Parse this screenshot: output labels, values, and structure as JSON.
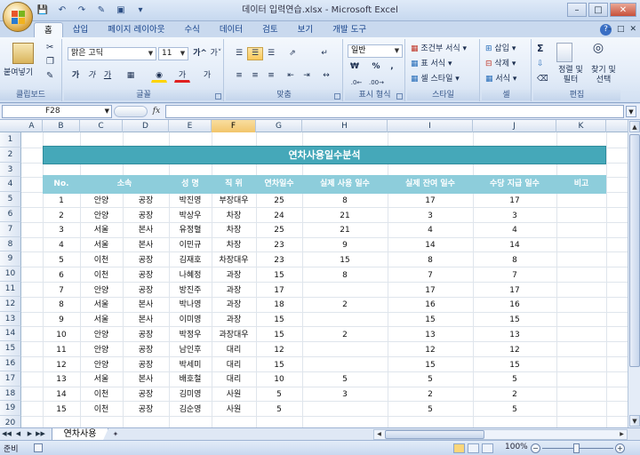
{
  "window": {
    "title": "데이터 입력연습.xlsx - Microsoft Excel",
    "controls": [
      "–",
      "□",
      "✕"
    ]
  },
  "tabs": [
    "홈",
    "삽입",
    "페이지 레이아웃",
    "수식",
    "데이터",
    "검토",
    "보기",
    "개발 도구"
  ],
  "active_tab": "홈",
  "ribbon": {
    "clipboard": {
      "label": "클립보드",
      "paste": "붙여넣기"
    },
    "font": {
      "label": "글꼴",
      "font_name": "맑은 고딕",
      "font_size": "11",
      "bold": "가",
      "italic": "가",
      "underline": "가",
      "grow": "가^",
      "shrink": "가˅"
    },
    "alignment": {
      "label": "맞춤"
    },
    "number": {
      "label": "표시 형식",
      "format": "일반",
      "currency": "₩",
      "percent": "%",
      "comma": ","
    },
    "styles": {
      "label": "스타일",
      "conditional": "조건부 서식",
      "table": "표 서식",
      "cell_style": "셀 스타일"
    },
    "cells": {
      "label": "셀",
      "insert": "삽입",
      "delete": "삭제",
      "format": "서식"
    },
    "editing": {
      "label": "편집",
      "sort_filter": "정렬 및 필터",
      "find_select": "찾기 및 선택",
      "sum": "Σ"
    }
  },
  "formula_bar": {
    "name_box": "F28",
    "fx": "fx",
    "value": ""
  },
  "columns": [
    "A",
    "B",
    "C",
    "D",
    "E",
    "F",
    "G",
    "H",
    "I",
    "J",
    "K"
  ],
  "selected_column": "F",
  "rows": [
    "1",
    "2",
    "3",
    "4",
    "5",
    "6",
    "7",
    "8",
    "9",
    "10",
    "11",
    "12",
    "13",
    "14",
    "15",
    "16",
    "17",
    "18",
    "19",
    "20"
  ],
  "sheet": {
    "title": "연차사용일수분석",
    "headers": [
      "No.",
      "소속",
      "성 명",
      "직 위",
      "연차일수",
      "실제 사용 일수",
      "실제 잔여 일수",
      "수당 지급 일수",
      "비고"
    ],
    "data": [
      [
        "1",
        "안양",
        "공장",
        "박진영",
        "부장대우",
        "25",
        "8",
        "17",
        "17",
        ""
      ],
      [
        "2",
        "안양",
        "공장",
        "박상우",
        "차장",
        "24",
        "21",
        "3",
        "3",
        ""
      ],
      [
        "3",
        "서울",
        "본사",
        "유정혈",
        "차장",
        "25",
        "21",
        "4",
        "4",
        ""
      ],
      [
        "4",
        "서울",
        "본사",
        "이민규",
        "차장",
        "23",
        "9",
        "14",
        "14",
        ""
      ],
      [
        "5",
        "이천",
        "공장",
        "김재호",
        "차장대우",
        "23",
        "15",
        "8",
        "8",
        ""
      ],
      [
        "6",
        "이천",
        "공장",
        "나혜정",
        "과장",
        "15",
        "8",
        "7",
        "7",
        ""
      ],
      [
        "7",
        "안양",
        "공장",
        "방진주",
        "과장",
        "17",
        "",
        "17",
        "17",
        ""
      ],
      [
        "8",
        "서울",
        "본사",
        "박나영",
        "과장",
        "18",
        "2",
        "16",
        "16",
        ""
      ],
      [
        "9",
        "서울",
        "본사",
        "이미영",
        "과장",
        "15",
        "",
        "15",
        "15",
        ""
      ],
      [
        "10",
        "안양",
        "공장",
        "박정우",
        "과장대우",
        "15",
        "2",
        "13",
        "13",
        ""
      ],
      [
        "11",
        "안양",
        "공장",
        "남인후",
        "대리",
        "12",
        "",
        "12",
        "12",
        ""
      ],
      [
        "12",
        "안양",
        "공장",
        "박세미",
        "대리",
        "15",
        "",
        "15",
        "15",
        ""
      ],
      [
        "13",
        "서울",
        "본사",
        "배호철",
        "대리",
        "10",
        "5",
        "5",
        "5",
        ""
      ],
      [
        "14",
        "이천",
        "공장",
        "김미영",
        "사원",
        "5",
        "3",
        "2",
        "2",
        ""
      ],
      [
        "15",
        "이천",
        "공장",
        "김순영",
        "사원",
        "5",
        "",
        "5",
        "5",
        ""
      ]
    ]
  },
  "sheet_tabs": [
    "연차사용"
  ],
  "status": {
    "ready": "준비",
    "zoom": "100%"
  }
}
